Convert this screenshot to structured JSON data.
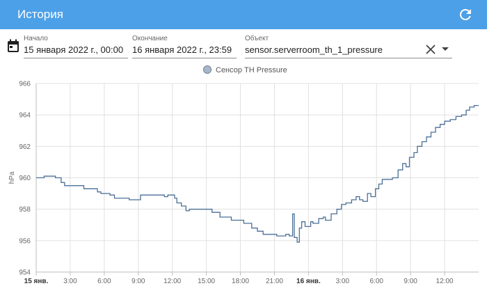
{
  "header": {
    "title": "История",
    "refresh_icon": "refresh-icon"
  },
  "filters": {
    "start_label": "Начало",
    "start_value": "15 января 2022 г., 00:00",
    "end_label": "Окончание",
    "end_value": "16 января 2022 г., 23:59",
    "entity_label": "Объект",
    "entity_value": "sensor.serverroom_th_1_pressure"
  },
  "chart_data": {
    "type": "line",
    "title": "",
    "ylabel": "hPa",
    "xlabel": "",
    "ylim": [
      954,
      966
    ],
    "xlim": [
      0,
      39
    ],
    "grid": true,
    "legend": {
      "position": "top-center",
      "entries": [
        "Сенсор TH Pressure"
      ]
    },
    "y_ticks": [
      "954",
      "956",
      "958",
      "960",
      "962",
      "964",
      "966"
    ],
    "x_ticks": [
      {
        "h": 0,
        "label": "15 янв.",
        "bold": true
      },
      {
        "h": 3,
        "label": "3:00",
        "bold": false
      },
      {
        "h": 6,
        "label": "6:00",
        "bold": false
      },
      {
        "h": 9,
        "label": "9:00",
        "bold": false
      },
      {
        "h": 12,
        "label": "12:00",
        "bold": false
      },
      {
        "h": 15,
        "label": "15:00",
        "bold": false
      },
      {
        "h": 18,
        "label": "18:00",
        "bold": false
      },
      {
        "h": 21,
        "label": "21:00",
        "bold": false
      },
      {
        "h": 24,
        "label": "16 янв.",
        "bold": true
      },
      {
        "h": 27,
        "label": "3:00",
        "bold": false
      },
      {
        "h": 30,
        "label": "6:00",
        "bold": false
      },
      {
        "h": 33,
        "label": "9:00",
        "bold": false
      },
      {
        "h": 36,
        "label": "12:00",
        "bold": false
      }
    ],
    "series": [
      {
        "name": "Сенсор TH Pressure",
        "color": "#4a6f96",
        "step": true,
        "points": [
          [
            0,
            960.0
          ],
          [
            0.7,
            960.1
          ],
          [
            1.7,
            960.0
          ],
          [
            2.2,
            959.7
          ],
          [
            2.5,
            959.5
          ],
          [
            4.2,
            959.3
          ],
          [
            5.4,
            959.1
          ],
          [
            5.7,
            959.0
          ],
          [
            6.5,
            958.9
          ],
          [
            6.9,
            958.7
          ],
          [
            7.8,
            958.7
          ],
          [
            8.2,
            958.6
          ],
          [
            9.0,
            958.6
          ],
          [
            9.2,
            958.9
          ],
          [
            11.0,
            958.9
          ],
          [
            11.3,
            958.8
          ],
          [
            11.6,
            958.9
          ],
          [
            12.0,
            958.9
          ],
          [
            12.2,
            958.7
          ],
          [
            12.4,
            958.4
          ],
          [
            12.8,
            958.2
          ],
          [
            13.2,
            957.9
          ],
          [
            13.5,
            958.0
          ],
          [
            15.0,
            958.0
          ],
          [
            15.5,
            957.8
          ],
          [
            16.2,
            957.5
          ],
          [
            17.2,
            957.3
          ],
          [
            18.3,
            957.1
          ],
          [
            19.0,
            956.8
          ],
          [
            19.5,
            956.6
          ],
          [
            20.0,
            956.4
          ],
          [
            20.5,
            956.4
          ],
          [
            21.2,
            956.3
          ],
          [
            21.6,
            956.3
          ],
          [
            22.0,
            956.4
          ],
          [
            22.3,
            956.3
          ],
          [
            22.6,
            957.7
          ],
          [
            22.75,
            956.2
          ],
          [
            23.0,
            955.9
          ],
          [
            23.2,
            956.8
          ],
          [
            23.4,
            957.2
          ],
          [
            23.7,
            956.9
          ],
          [
            24.2,
            957.2
          ],
          [
            24.4,
            957.1
          ],
          [
            24.9,
            957.4
          ],
          [
            25.3,
            957.5
          ],
          [
            25.5,
            957.3
          ],
          [
            26.0,
            957.7
          ],
          [
            26.5,
            958.0
          ],
          [
            26.9,
            958.3
          ],
          [
            27.3,
            958.4
          ],
          [
            27.8,
            958.6
          ],
          [
            28.2,
            958.8
          ],
          [
            28.5,
            958.6
          ],
          [
            28.8,
            958.5
          ],
          [
            29.2,
            959.0
          ],
          [
            29.5,
            958.8
          ],
          [
            29.9,
            959.3
          ],
          [
            30.2,
            959.6
          ],
          [
            30.5,
            959.9
          ],
          [
            31.1,
            959.9
          ],
          [
            31.4,
            960.0
          ],
          [
            31.9,
            960.5
          ],
          [
            32.3,
            960.9
          ],
          [
            32.6,
            960.7
          ],
          [
            32.9,
            961.3
          ],
          [
            33.3,
            961.6
          ],
          [
            33.6,
            962.0
          ],
          [
            34.0,
            962.3
          ],
          [
            34.4,
            962.6
          ],
          [
            34.8,
            962.9
          ],
          [
            35.2,
            963.2
          ],
          [
            35.6,
            963.4
          ],
          [
            36.0,
            963.6
          ],
          [
            36.5,
            963.7
          ],
          [
            37.0,
            963.9
          ],
          [
            37.5,
            964.0
          ],
          [
            37.9,
            964.3
          ],
          [
            38.2,
            964.5
          ],
          [
            38.6,
            964.6
          ],
          [
            39.0,
            964.6
          ]
        ]
      }
    ]
  }
}
